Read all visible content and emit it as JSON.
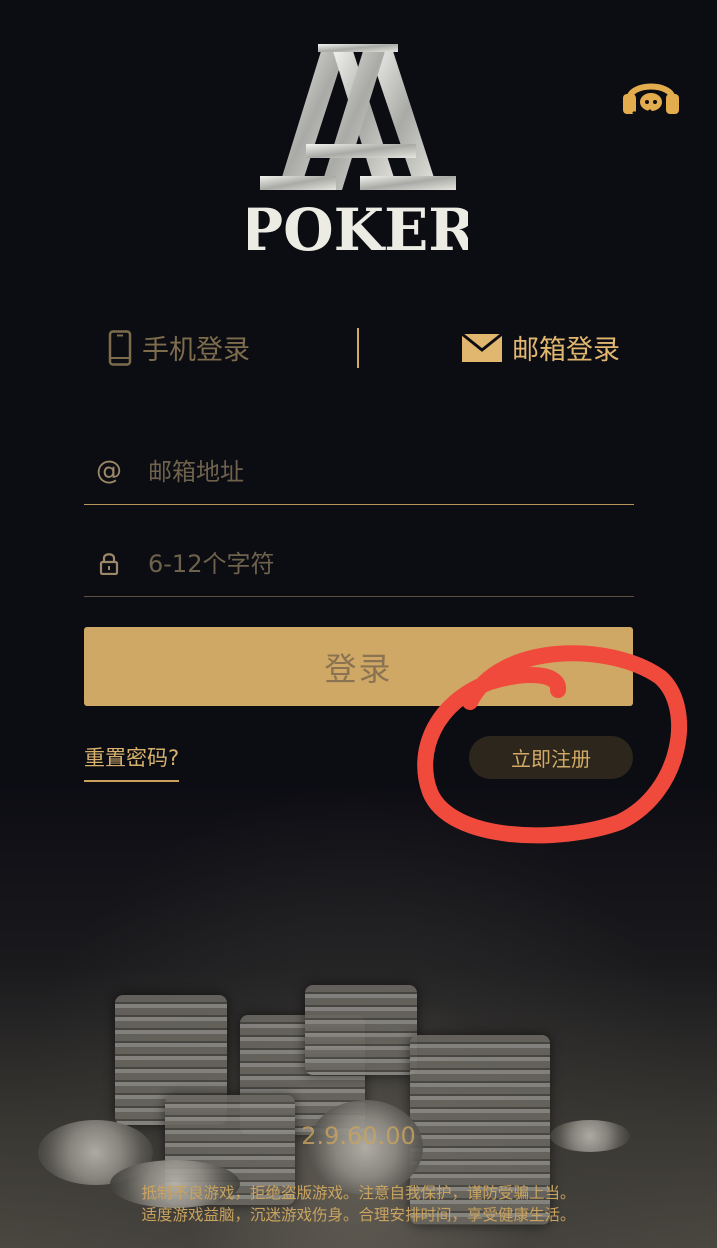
{
  "logo": {
    "aa_letters": "AA",
    "brand": "POKER"
  },
  "support": {
    "icon": "headset-icon"
  },
  "login_tabs": {
    "phone": {
      "icon": "phone-icon",
      "label": "手机登录"
    },
    "email": {
      "icon": "envelope-icon",
      "label": "邮箱登录",
      "active": true
    }
  },
  "form": {
    "email": {
      "icon": "at-icon",
      "placeholder": "邮箱地址",
      "value": ""
    },
    "password": {
      "icon": "lock-icon",
      "placeholder": "6-12个字符",
      "value": ""
    },
    "login_label": "登录",
    "reset_label": "重置密码?",
    "register_label": "立即注册"
  },
  "footer": {
    "version": "2.9.60.00",
    "line1": "抵制不良游戏，拒绝盗版游戏。注意自我保护，谨防受骗上当。",
    "line2": "适度游戏益脑，沉迷游戏伤身。合理安排时间，享受健康生活。"
  },
  "colors": {
    "background": "#0c0c13",
    "gold": "#d0a865",
    "annotation": "#f04a3d"
  }
}
